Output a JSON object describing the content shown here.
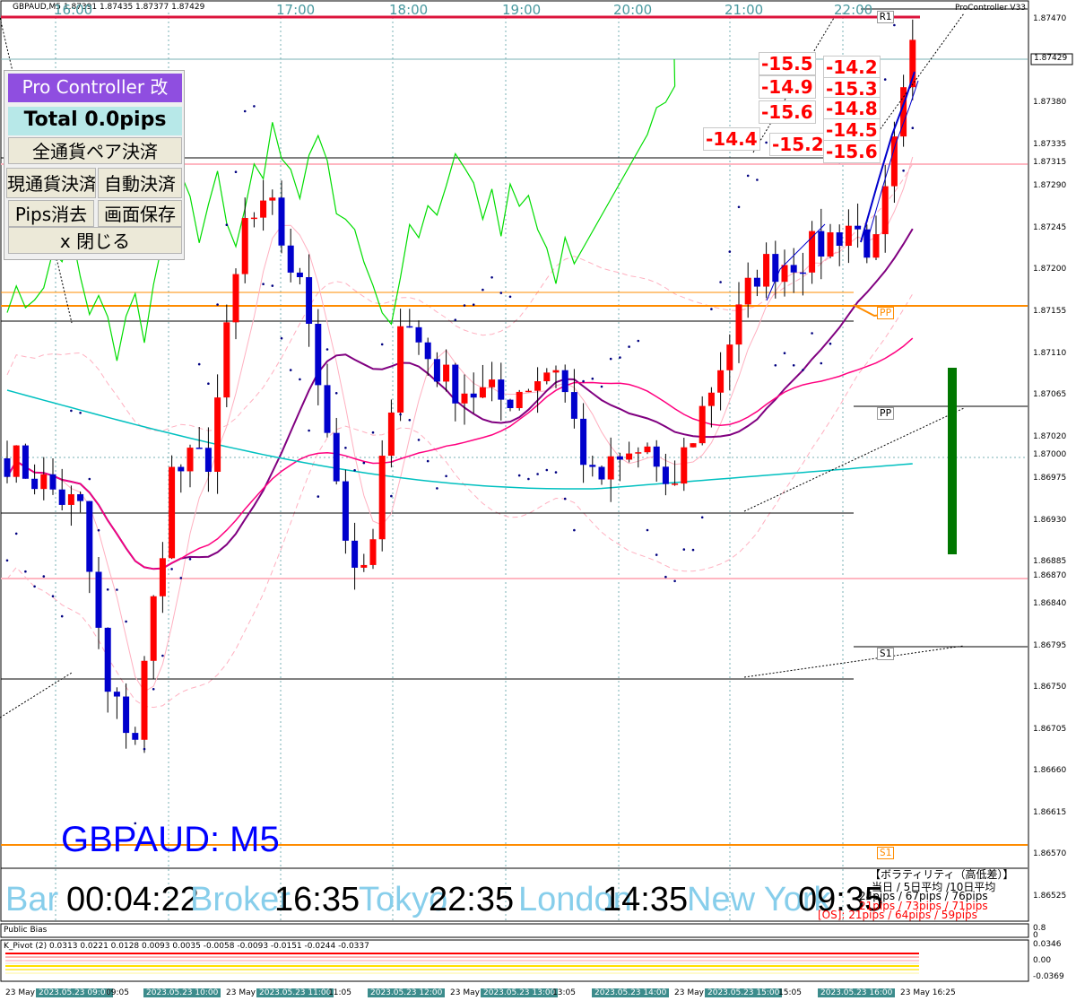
{
  "chart_header": "GBPAUD,M5  1.87391 1.87435 1.87377 1.87429",
  "indicator_name": "ProController V33",
  "time_axis_top": [
    "16:00",
    "17:00",
    "18:00",
    "19:00",
    "20:00",
    "21:00",
    "22:00"
  ],
  "price_axis": [
    "1.87470",
    "1.87429",
    "1.87380",
    "1.87335",
    "1.87315",
    "1.87290",
    "1.87245",
    "1.87200",
    "1.87155",
    "1.87110",
    "1.87065",
    "1.87020",
    "1.87000",
    "1.86975",
    "1.86930",
    "1.86885",
    "1.86870",
    "1.86840",
    "1.86795",
    "1.86750",
    "1.86705",
    "1.86660",
    "1.86615",
    "1.86570",
    "1.86525"
  ],
  "current_price": "1.87429",
  "panel": {
    "title": "Pro Controller 改",
    "total": "Total   0.0pips",
    "close_all": "全通貨ペア決済",
    "close_current": "現通貨決済",
    "auto_close": "自動決済",
    "clear_pips": "Pips消去",
    "save_screen": "画面保存",
    "close_panel": "x 閉じる"
  },
  "pips_labels": [
    "-15.5",
    "-14.9",
    "-15.6",
    "-14.4",
    "-15.2",
    "-14.2",
    "-15.3",
    "-14.8",
    "-14.5",
    "-15.6"
  ],
  "pivot_labels": {
    "r1": "R1",
    "pp_top": "PP",
    "pp": "PP",
    "s1": "S1",
    "s1_bottom": "S1"
  },
  "symbol_label": "GBPAUD: M5",
  "info_bar": {
    "bar_label": "Bar",
    "bar_time": "00:04:22",
    "broker_label": "Broker",
    "broker_time": "16:35",
    "tokyo_label": "Tokyo",
    "tokyo_time": "22:35",
    "london_label": "London",
    "london_time": "14:35",
    "newyork_label": "New York",
    "newyork_time": "09:35"
  },
  "volatility": {
    "title": "【ボラティリティ（高低差）】",
    "header": "当日 / 5日平均 /10日平均",
    "row1": "24pips /  67pips /  76pips",
    "row2": "21pips /  73pips /  71pips",
    "row3": "[OS]: 21pips /  64pips /  59pips"
  },
  "subwindow1": {
    "name": "Public Bias",
    "scale_top": "0.8",
    "scale_bottom": "0"
  },
  "subwindow2": {
    "name": "K_Pivot (2) 0.0313 0.0221 0.0128 0.0093 0.0035 -0.0058 -0.0093 -0.0151 -0.0244 -0.0337",
    "scale": [
      "0.0346",
      "0.00",
      "-0.0369"
    ]
  },
  "bottom_axis": [
    {
      "text": "23 May",
      "hl": false
    },
    {
      "text": "2023.05.23 09:00",
      "hl": true
    },
    {
      "text": "09:05",
      "hl": false
    },
    {
      "text": "2023.05.23 10:00",
      "hl": true
    },
    {
      "text": "23 May",
      "hl": false
    },
    {
      "text": "2023.05.23 11:00",
      "hl": true
    },
    {
      "text": "11:05",
      "hl": false
    },
    {
      "text": "2023.05.23 12:00",
      "hl": true
    },
    {
      "text": "23 May",
      "hl": false
    },
    {
      "text": "2023.05.23 13:00",
      "hl": true
    },
    {
      "text": "13:05",
      "hl": false
    },
    {
      "text": "2023.05.23 14:00",
      "hl": true
    },
    {
      "text": "23 May",
      "hl": false
    },
    {
      "text": "2023.05.23 15:00",
      "hl": true
    },
    {
      "text": "15:05",
      "hl": false
    },
    {
      "text": "2023.05.23 16:00",
      "hl": true
    },
    {
      "text": "23 May 16:25",
      "hl": false
    }
  ],
  "colors": {
    "bull": "#ff0000",
    "bear": "#0000cc",
    "ma_purple": "#800080",
    "ma_magenta": "#ff007f",
    "ma_cyan": "#00c0c0",
    "oscillator": "#00dd00",
    "pivot_orange": "#ff8c00",
    "band_pink": "#ffb0c0",
    "volume_bar": "#007700"
  }
}
